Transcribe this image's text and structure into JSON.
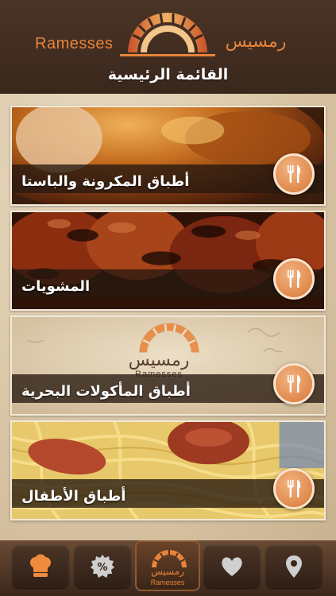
{
  "header": {
    "brand_en": "Ramesses",
    "brand_ar": "رمسيس",
    "title": "القائمة الرئيسية"
  },
  "menu": {
    "items": [
      {
        "label": "أطباق المكرونة والباستا",
        "photo": "roast-chicken",
        "icon": "fork-knife-icon"
      },
      {
        "label": "المشويات",
        "photo": "grilled-meat",
        "icon": "fork-knife-icon"
      },
      {
        "label": "أطباق المأكولات البحرية",
        "photo": "logo-parchment",
        "icon": "fork-knife-icon"
      },
      {
        "label": "أطباق الأطفال",
        "photo": "spaghetti-hotdog",
        "icon": "fork-knife-icon"
      }
    ],
    "watermark_ar": "رمسيس",
    "watermark_en": "Ramesses"
  },
  "tabbar": {
    "tabs": [
      {
        "icon": "chef-hat-icon"
      },
      {
        "icon": "discount-badge-icon"
      },
      {
        "icon": "home-logo-icon"
      },
      {
        "icon": "heart-icon"
      },
      {
        "icon": "location-pin-icon"
      }
    ],
    "center_ar": "رمسيس",
    "center_en": "Ramesses"
  },
  "colors": {
    "accent": "#e8833a",
    "header_bg": "#3a271c",
    "bar_bg": "#261810"
  }
}
